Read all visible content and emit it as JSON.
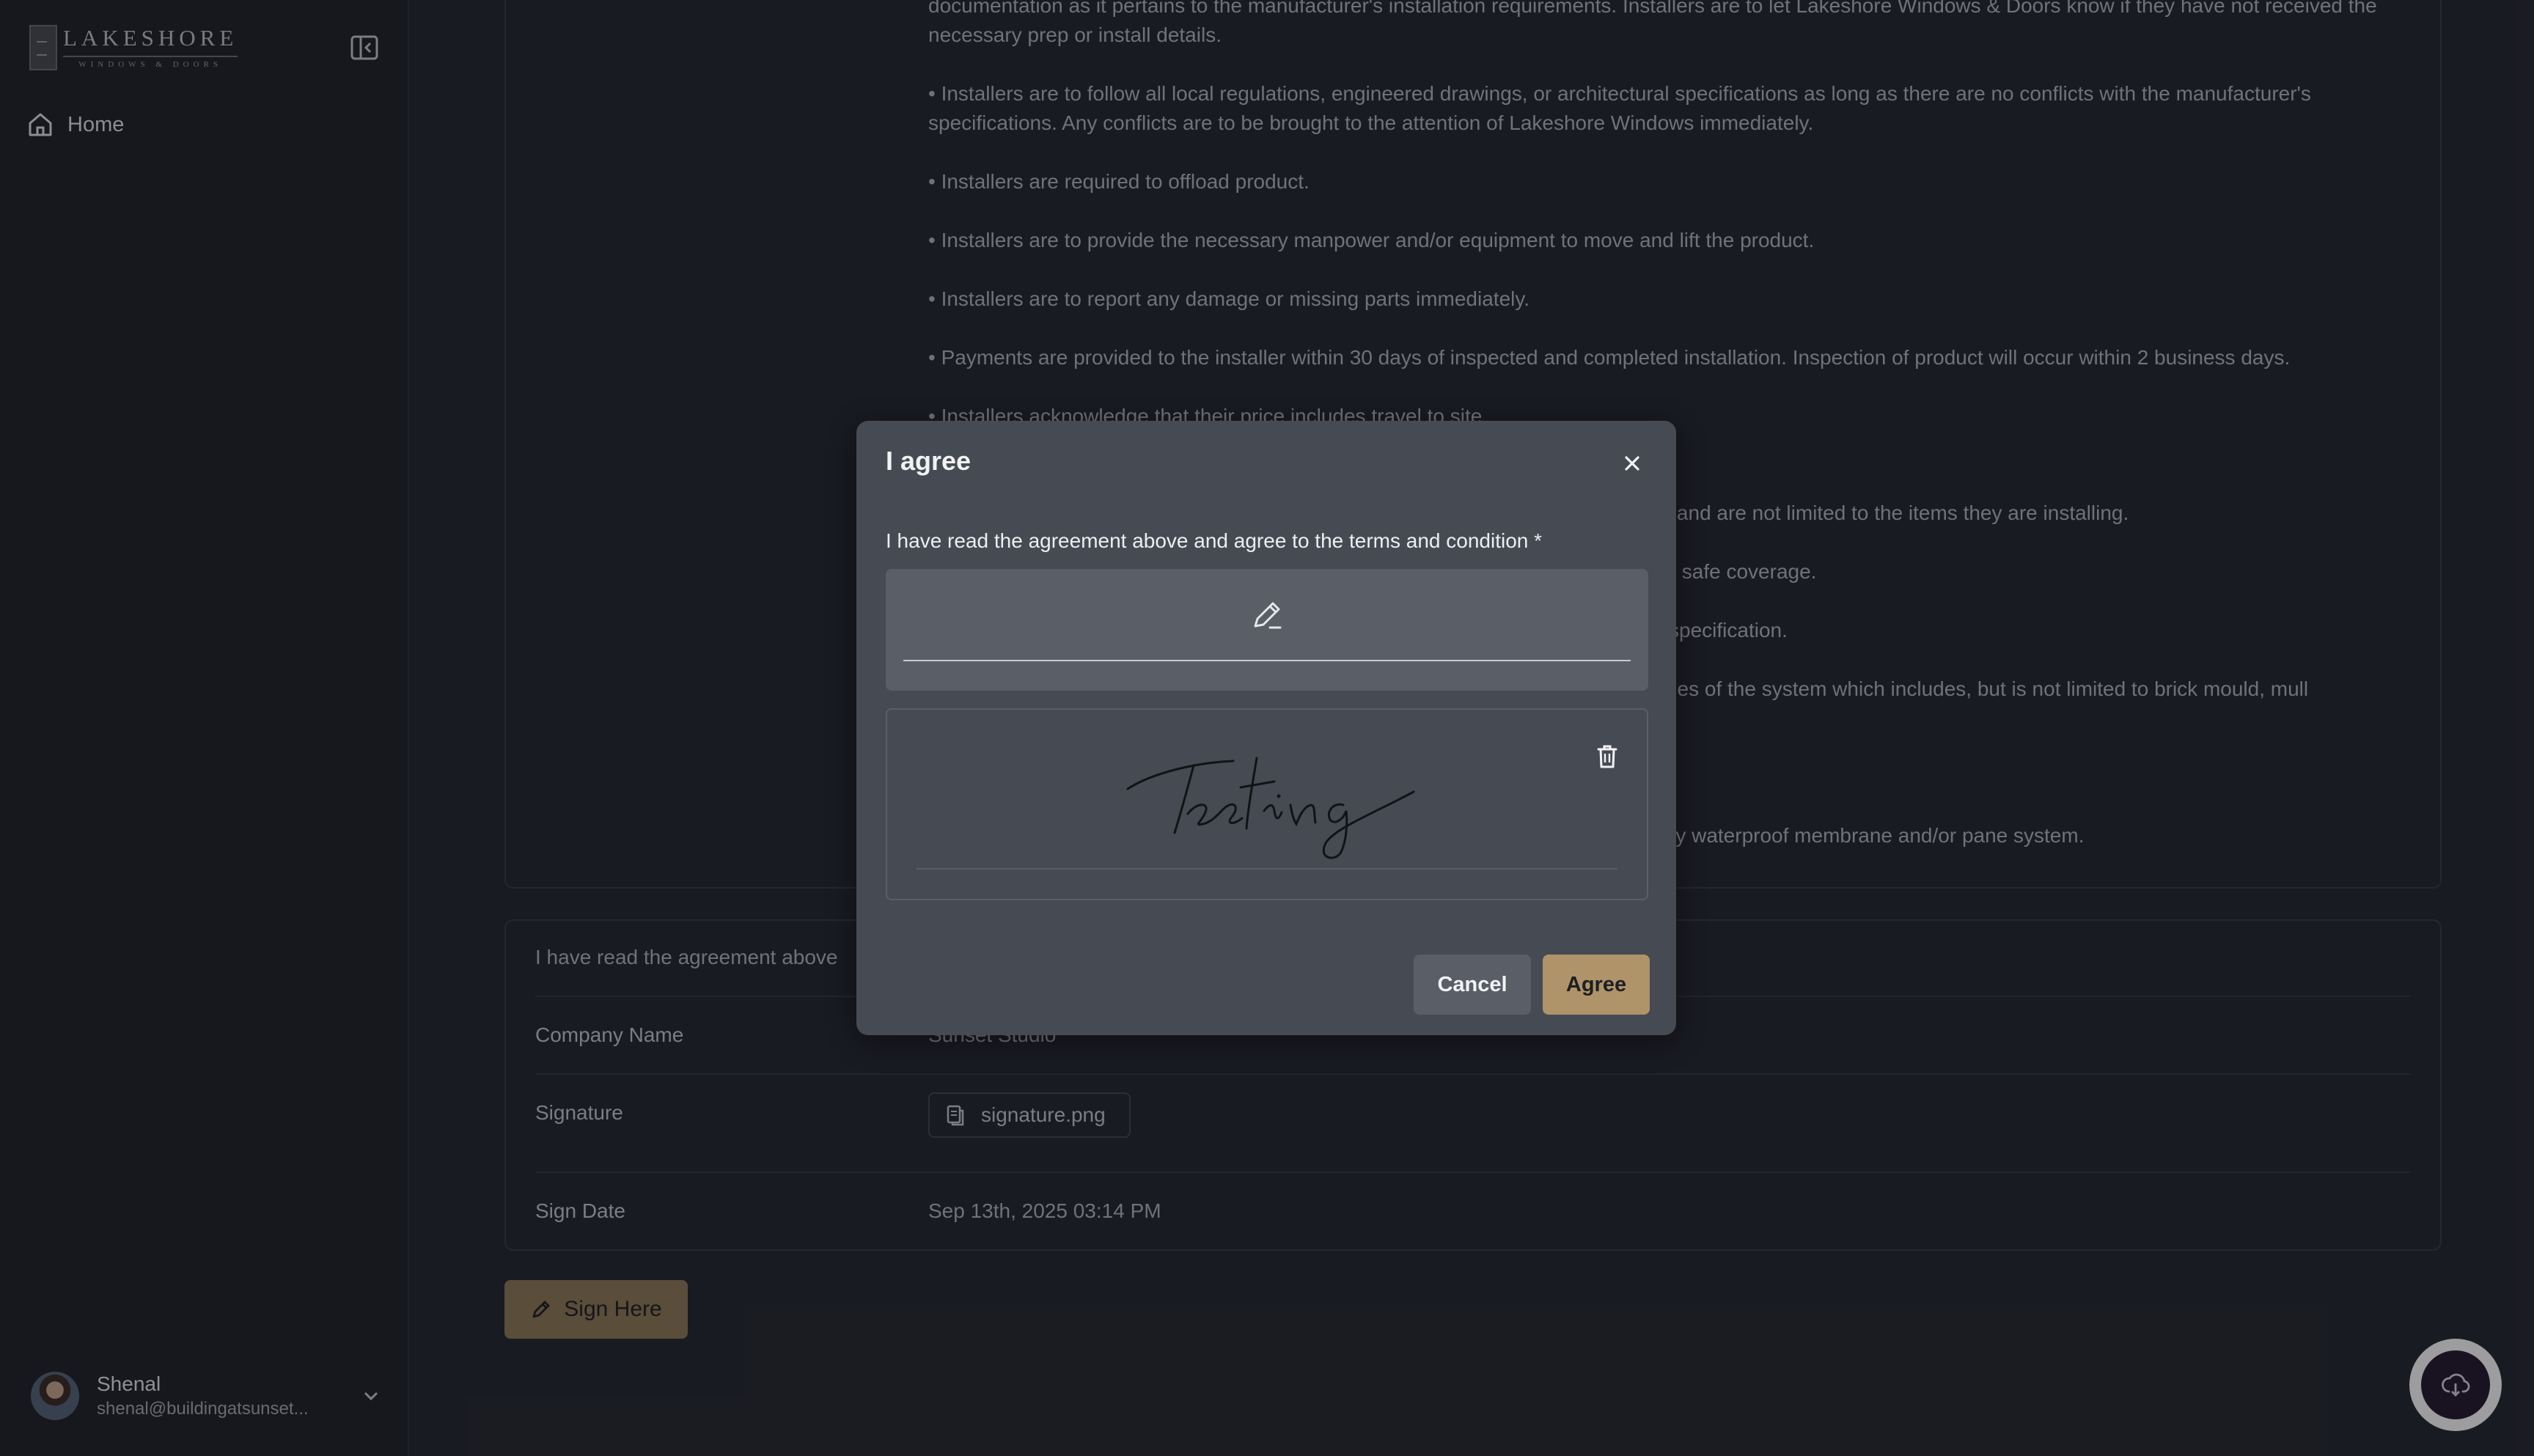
{
  "sidebar": {
    "logo_title": "LAKESHORE",
    "logo_subtitle": "WINDOWS & DOORS",
    "nav_home": "Home",
    "user": {
      "name": "Shenal",
      "email": "shenal@buildingatsunset..."
    }
  },
  "terms": {
    "items": [
      "documentation as it pertains to the manufacturer's installation requirements. Installers are to let Lakeshore Windows & Doors know if they have not received the necessary prep or install details.",
      "• Installers are to follow all local regulations, engineered drawings, or architectural specifications as long as there are no conflicts with the manufacturer's specifications. Any conflicts are to be brought to the attention of Lakeshore Windows immediately.",
      "• Installers are required to offload product.",
      "• Installers are to provide the necessary manpower and/or equipment to move and lift the product.",
      "• Installers are to report any damage or missing parts immediately.",
      "• Payments are provided to the installer within 30 days of inspected and completed installation. Inspection of product will occur within 2 business days.",
      "• Installers acknowledge that their price includes travel to site."
    ],
    "tails": [
      "nsite and are not limited to the items they are installing.",
      "k safe coverage.",
      "specification.",
      "ries of the system which includes, but is not limited to brick mould, mull",
      "ry waterproof membrane and/or pane system."
    ]
  },
  "details": {
    "agreement_text": "I have read the agreement above",
    "company_label": "Company Name",
    "company_value": "Sunset Studio",
    "signature_label": "Signature",
    "signature_file": "signature.png",
    "sign_date_label": "Sign Date",
    "sign_date_value": "Sep 13th, 2025 03:14 PM"
  },
  "sign_here_label": "Sign Here",
  "modal": {
    "title": "I agree",
    "label": "I have read the agreement above and agree to the terms and condition",
    "required_mark": "*",
    "signature_text": "Testing",
    "cancel_label": "Cancel",
    "agree_label": "Agree"
  },
  "colors": {
    "background": "#24272f",
    "sidebar": "#1f2229",
    "accent": "#ae9468",
    "modal": "#464a53"
  }
}
